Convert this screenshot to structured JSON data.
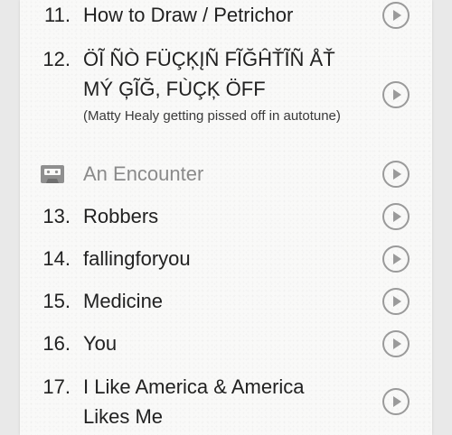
{
  "tracks": [
    {
      "number": "11.",
      "title": "How to Draw / Petrichor"
    },
    {
      "number": "12.",
      "title": "ÖĨ ÑÒ FÜÇĶĮÑ FĨĞĤŤĨÑ ÅŤ MÝ ĢĨĞ, FÙÇĶ ÖFF",
      "note": "(Matty Healy getting pissed off in autotune)"
    },
    {
      "interlude": true,
      "title": "An Encounter",
      "icon": "cassette-tape-icon"
    },
    {
      "number": "13.",
      "title": "Robbers"
    },
    {
      "number": "14.",
      "title": "fallingforyou"
    },
    {
      "number": "15.",
      "title": "Medicine"
    },
    {
      "number": "16.",
      "title": "You"
    },
    {
      "number": "17.",
      "title": "I Like America & America Likes Me"
    }
  ],
  "icons": {
    "play": "play-circle-icon",
    "interlude": "cassette-tape-icon"
  },
  "colors": {
    "background": "#e9e9e9",
    "card": "#f9f9f8",
    "text": "#212121",
    "interlude_text": "#8a8a8a",
    "play_icon": "#9a9a9a"
  }
}
